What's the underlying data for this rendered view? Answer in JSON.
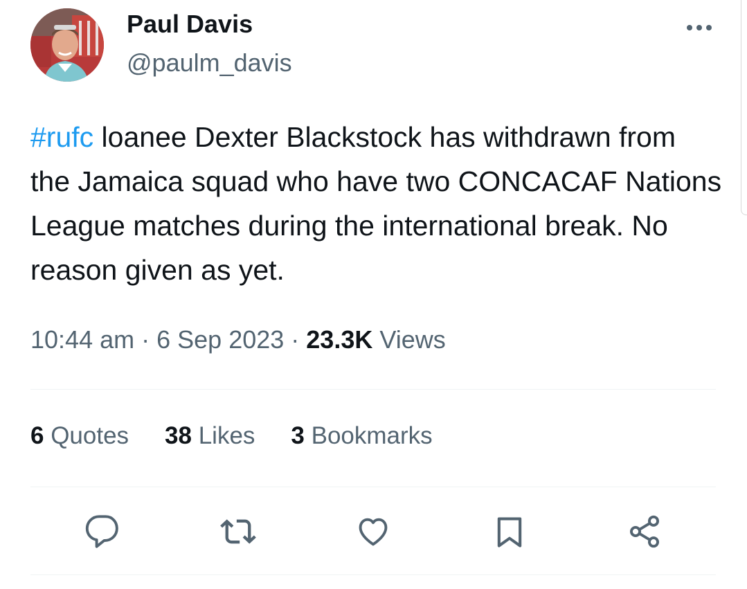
{
  "author": {
    "display_name": "Paul Davis",
    "handle": "@paulm_davis",
    "avatar_icon": "avatar-photo"
  },
  "tweet": {
    "hashtag": "#rufc",
    "body": " loanee Dexter Blackstock has withdrawn from the Jamaica squad who have two CONCACAF Nations League matches during the international break. No reason given as yet."
  },
  "meta": {
    "time": "10:44 am",
    "separator": " · ",
    "date": "6 Sep 2023",
    "views_count": "23.3K",
    "views_label": " Views"
  },
  "stats": {
    "quotes": {
      "count": "6",
      "label": " Quotes"
    },
    "likes": {
      "count": "38",
      "label": " Likes"
    },
    "bookmarks": {
      "count": "3",
      "label": " Bookmarks"
    }
  },
  "actions": [
    "reply-icon",
    "retweet-icon",
    "like-icon",
    "bookmark-icon",
    "share-icon"
  ],
  "colors": {
    "accent": "#1d9bf0",
    "text_primary": "#0f1419",
    "text_secondary": "#536471",
    "divider": "#eff3f4"
  }
}
